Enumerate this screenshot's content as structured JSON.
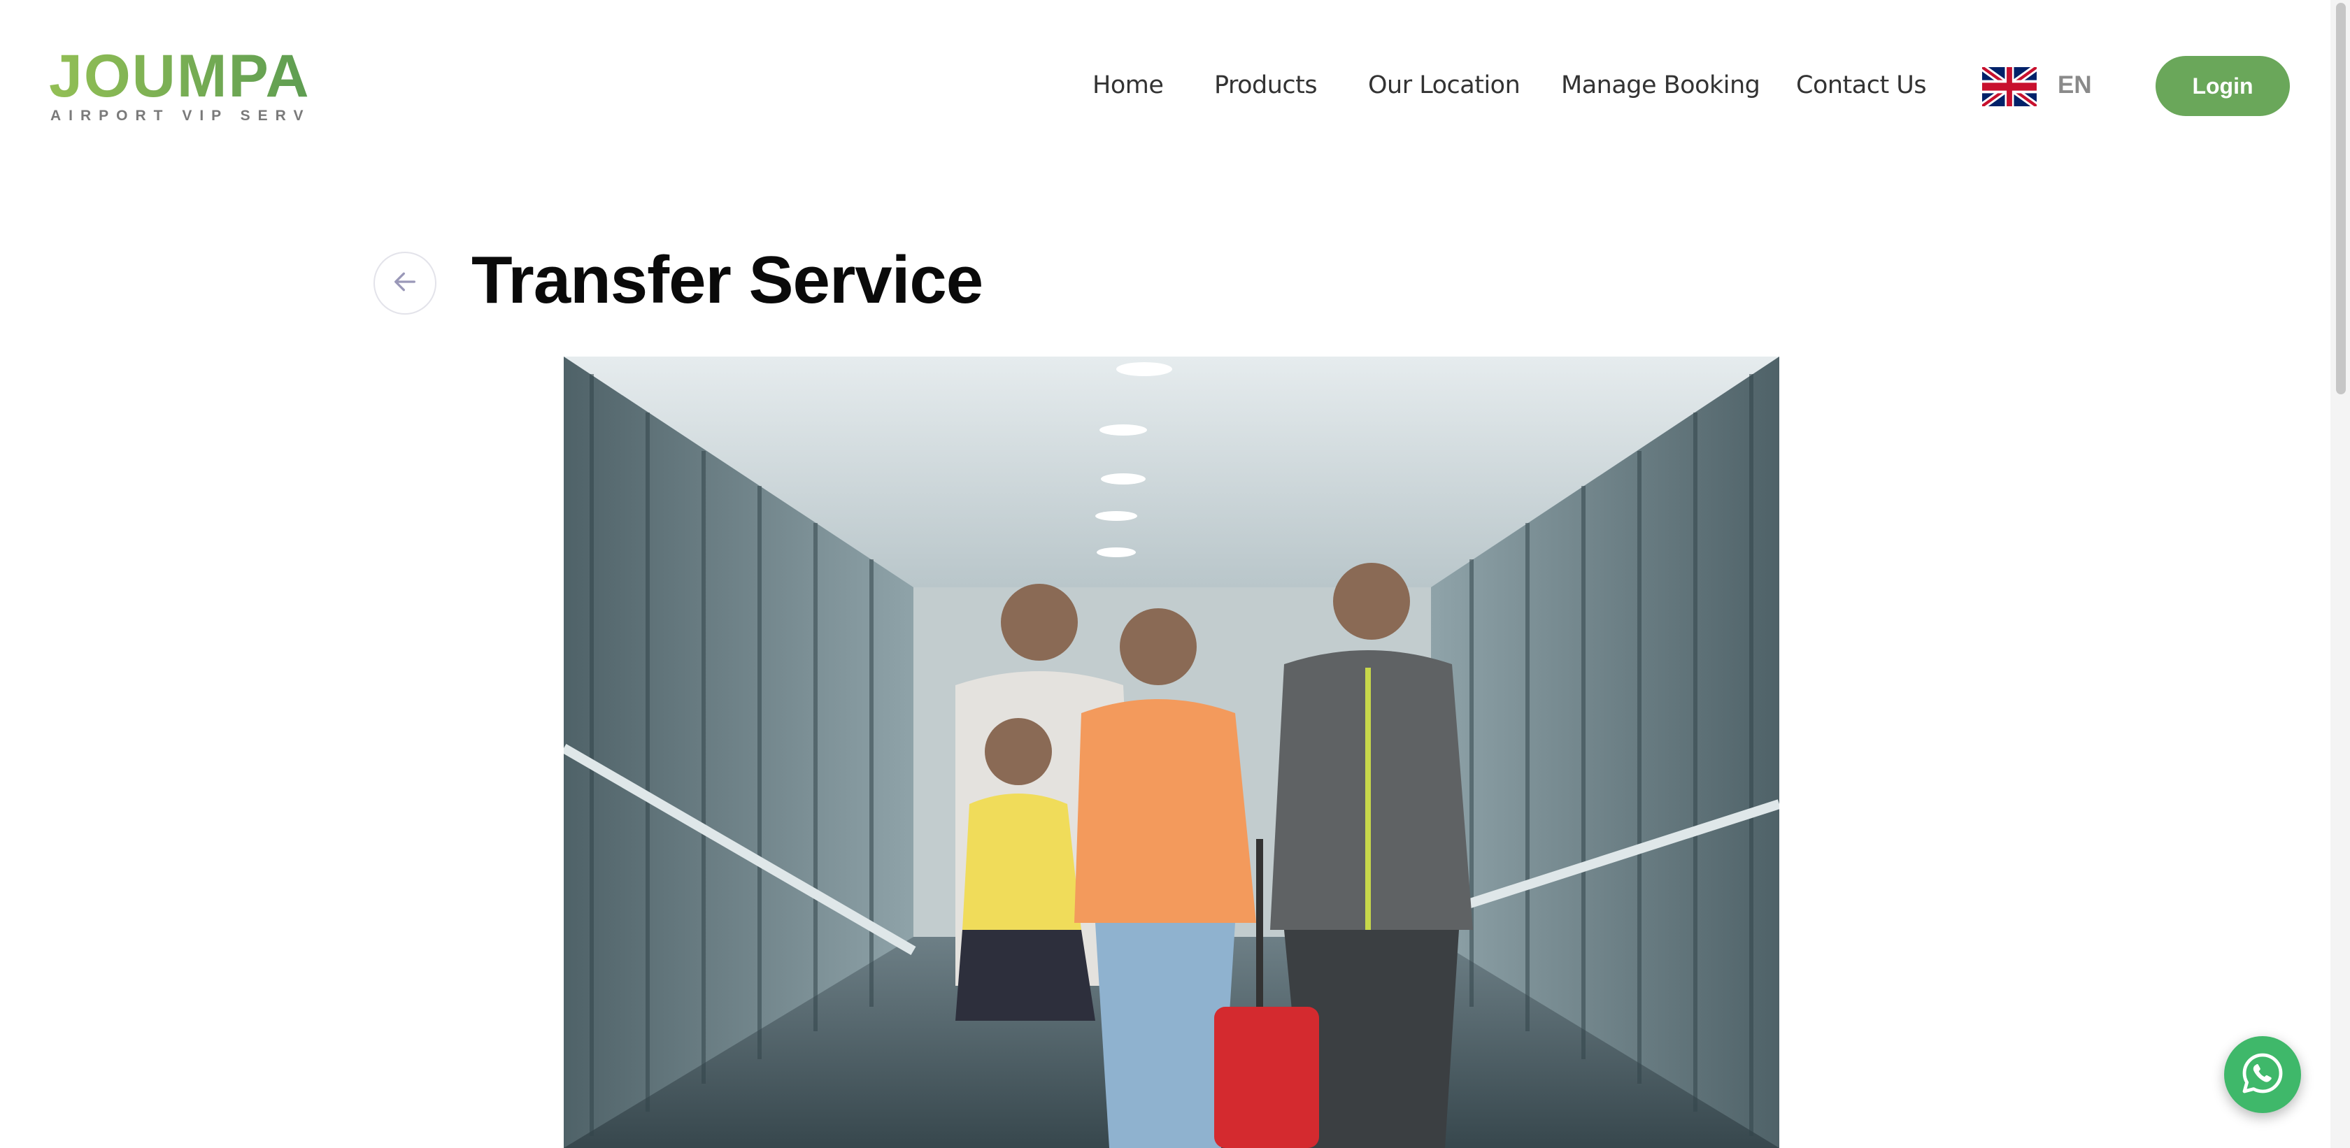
{
  "brand": {
    "name": "JOUMPA",
    "tagline": "AIRPORT VIP SERVICE",
    "color": "#6aa75a"
  },
  "nav": {
    "items": [
      {
        "label": "Home"
      },
      {
        "label": "Products"
      },
      {
        "label": "Our Location"
      },
      {
        "label": "Manage Booking"
      },
      {
        "label": "Contact Us"
      }
    ]
  },
  "language": {
    "code": "EN",
    "flag_icon": "uk-flag-icon"
  },
  "header": {
    "login_label": "Login"
  },
  "page": {
    "title": "Transfer Service",
    "back_icon": "arrow-left-icon",
    "hero_image": "Family walking through airport jet bridge with a service staff member"
  },
  "chat": {
    "icon": "whatsapp-icon",
    "color": "#3fb86a"
  }
}
